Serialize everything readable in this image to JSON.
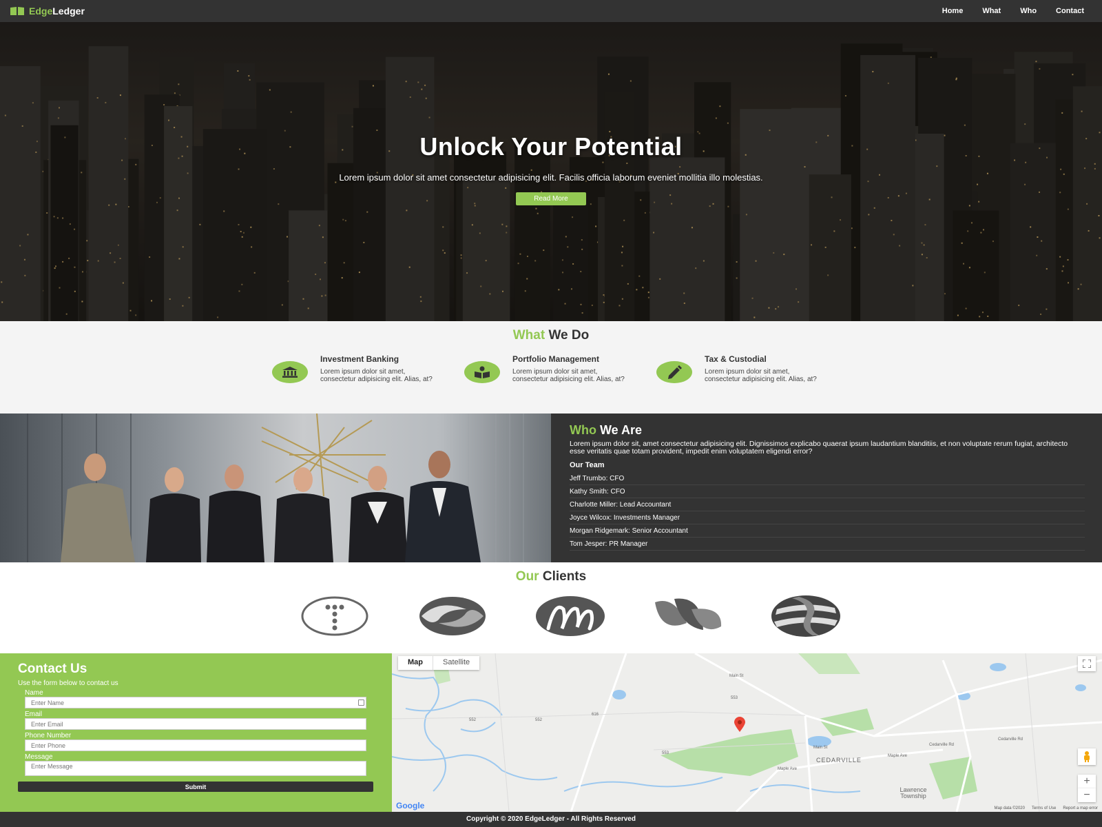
{
  "nav": {
    "brand_accent": "Edge",
    "brand_rest": "Ledger",
    "links": [
      "Home",
      "What",
      "Who",
      "Contact"
    ]
  },
  "hero": {
    "title": "Unlock Your Potential",
    "subtitle": "Lorem ipsum dolor sit amet consectetur adipisicing elit. Facilis officia laborum eveniet mollitia illo molestias.",
    "button": "Read More"
  },
  "what": {
    "title_accent": "What",
    "title_rest": " We Do",
    "services": [
      {
        "title": "Investment Banking",
        "text": "Lorem ipsum dolor sit amet, consectetur adipisicing elit. Alias, at?",
        "icon": "bank-icon"
      },
      {
        "title": "Portfolio Management",
        "text": "Lorem ipsum dolor sit amet, consectetur adipisicing elit. Alias, at?",
        "icon": "book-reader-icon"
      },
      {
        "title": "Tax & Custodial",
        "text": "Lorem ipsum dolor sit amet, consectetur adipisicing elit. Alias, at?",
        "icon": "pencil-icon"
      }
    ]
  },
  "who": {
    "title_accent": "Who",
    "title_rest": " We Are",
    "description": "Lorem ipsum dolor sit, amet consectetur adipisicing elit. Dignissimos explicabo quaerat ipsum laudantium blanditiis, et non voluptate rerum fugiat, architecto esse veritatis quae totam provident, impedit enim voluptatem eligendi error?",
    "team_heading": "Our Team",
    "team": [
      "Jeff Trumbo: CFO",
      "Kathy Smith: CFO",
      "Charlotte Miller: Lead Accountant",
      "Joyce Wilcox: Investments Manager",
      "Morgan Ridgemark: Senior Accountant",
      "Tom Jesper: PR Manager"
    ]
  },
  "clients": {
    "title_accent": "Our",
    "title_rest": " Clients"
  },
  "contact": {
    "title": "Contact Us",
    "subtitle": "Use the form below to contact us",
    "fields": [
      {
        "label": "Name",
        "placeholder": "Enter Name"
      },
      {
        "label": "Email",
        "placeholder": "Enter Email"
      },
      {
        "label": "Phone Number",
        "placeholder": "Enter Phone"
      },
      {
        "label": "Message",
        "placeholder": "Enter Message"
      }
    ],
    "submit": "Submit"
  },
  "map": {
    "tab_map": "Map",
    "tab_satellite": "Satellite",
    "place": "CEDARVILLE",
    "place2": "Lawrence Township",
    "roads": [
      "Cedarville Rd",
      "Cedarville Rd",
      "Maple Ave",
      "Maple Ave",
      "Main St",
      "Main St"
    ],
    "shields": [
      "553",
      "552",
      "552",
      "616",
      "553"
    ],
    "google": "Google",
    "footer": [
      "Map data ©2020",
      "Terms of Use",
      "Report a map error"
    ]
  },
  "footer": {
    "text": "Copyright © 2020 EdgeLedger - All Rights Reserved"
  },
  "colors": {
    "accent": "#93c853",
    "dark": "#333333"
  }
}
